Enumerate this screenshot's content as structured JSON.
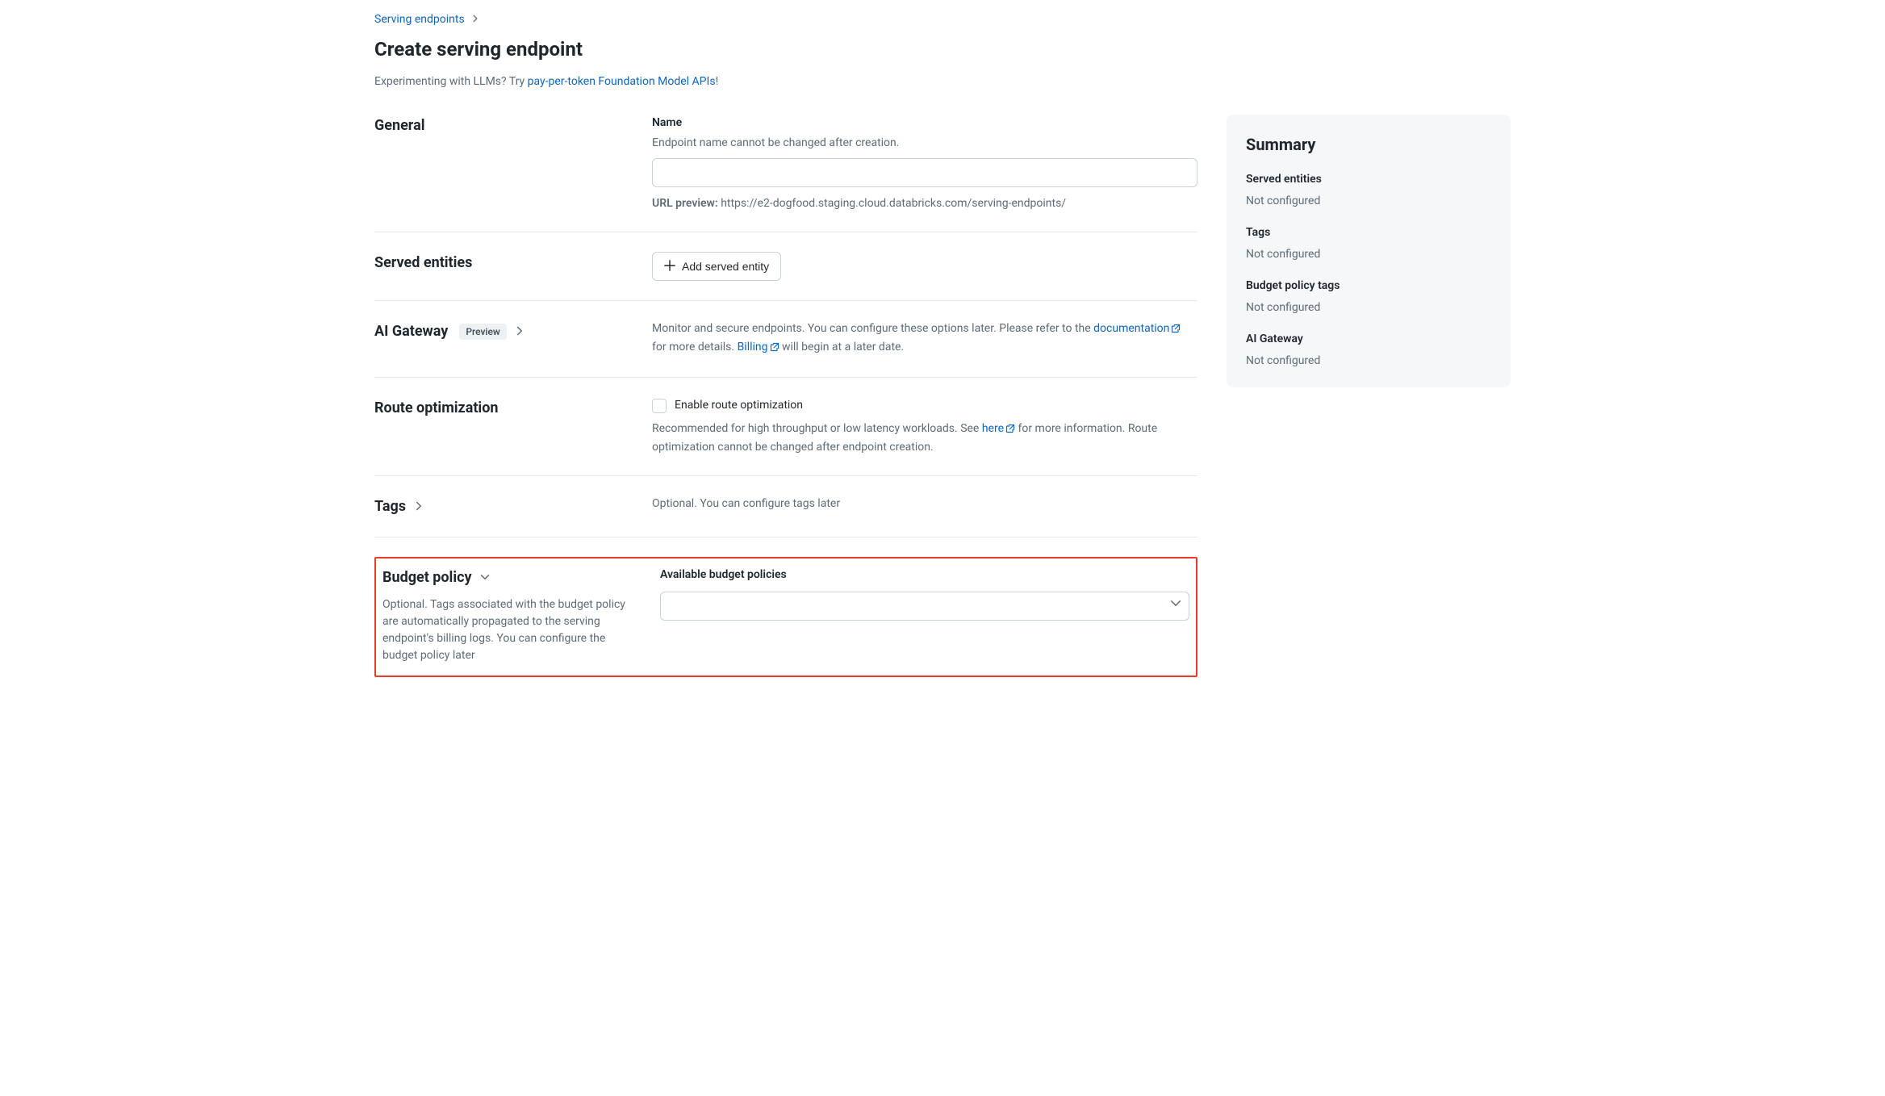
{
  "breadcrumb": {
    "parent": "Serving endpoints"
  },
  "page_title": "Create serving endpoint",
  "subtitle": {
    "prefix": "Experimenting with LLMs? Try ",
    "link": "pay-per-token Foundation Model APIs",
    "suffix": "!"
  },
  "general": {
    "heading": "General",
    "name_label": "Name",
    "name_hint": "Endpoint name cannot be changed after creation.",
    "name_value": "",
    "url_preview_label": "URL preview:",
    "url_preview_value": "https://e2-dogfood.staging.cloud.databricks.com/serving-endpoints/"
  },
  "served": {
    "heading": "Served entities",
    "add_button": "Add served entity"
  },
  "ai_gateway": {
    "heading": "AI Gateway",
    "badge": "Preview",
    "desc_prefix": "Monitor and secure endpoints. You can configure these options later. Please refer to the ",
    "doc_link": "documentation",
    "desc_mid": " for more details. ",
    "billing_link": "Billing",
    "desc_suffix": " will begin at a later date."
  },
  "route_opt": {
    "heading": "Route optimization",
    "checkbox_label": "Enable route optimization",
    "desc_prefix": "Recommended for high throughput or low latency workloads. See ",
    "here_link": "here",
    "desc_suffix": " for more information. Route optimization cannot be changed after endpoint creation."
  },
  "tags": {
    "heading": "Tags",
    "desc": "Optional. You can configure tags later"
  },
  "budget": {
    "heading": "Budget policy",
    "desc": "Optional. Tags associated with the budget policy are automatically propagated to the serving endpoint's billing logs. You can configure the budget policy later",
    "available_label": "Available budget policies",
    "selected": ""
  },
  "summary": {
    "heading": "Summary",
    "items": [
      {
        "label": "Served entities",
        "value": "Not configured"
      },
      {
        "label": "Tags",
        "value": "Not configured"
      },
      {
        "label": "Budget policy tags",
        "value": "Not configured"
      },
      {
        "label": "AI Gateway",
        "value": "Not configured"
      }
    ]
  }
}
